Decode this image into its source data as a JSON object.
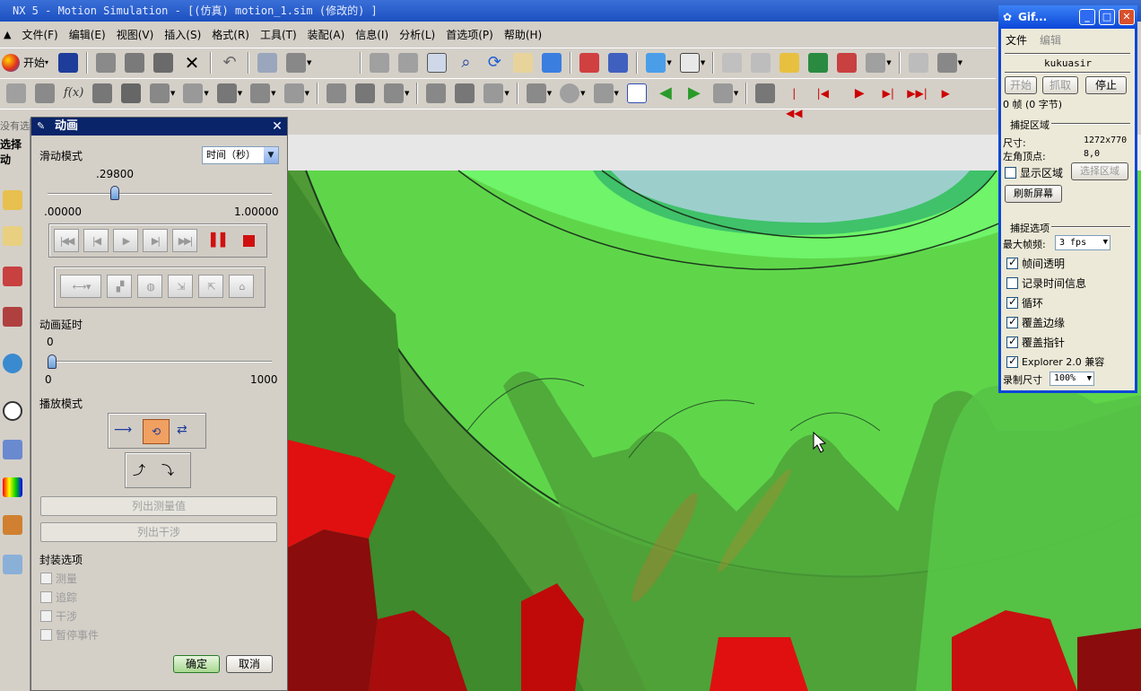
{
  "window": {
    "title": "NX 5 - Motion Simulation - [(仿真) motion_1.sim  (修改的) ]"
  },
  "menu": [
    "文件(F)",
    "编辑(E)",
    "视图(V)",
    "插入(S)",
    "格式(R)",
    "工具(T)",
    "装配(A)",
    "信息(I)",
    "分析(L)",
    "首选项(P)",
    "帮助(H)"
  ],
  "toolbar": {
    "start_label": "开始"
  },
  "left_partial": {
    "text1": "没有选",
    "text2": "选择动"
  },
  "anim": {
    "title": "动画",
    "slide_mode_label": "滑动模式",
    "slide_mode_value": "时间（秒）",
    "time_value": ".29800",
    "time_min": ".00000",
    "time_max": "1.00000",
    "time_fraction": 0.298,
    "delay_label": "动画延时",
    "delay_value": "0",
    "delay_min": "0",
    "delay_max": "1000",
    "play_mode_label": "播放模式",
    "btn_list_measure": "列出测量值",
    "btn_list_interference": "列出干涉",
    "package_label": "封装选项",
    "options": [
      "测量",
      "追踪",
      "干涉",
      "暂停事件"
    ],
    "ok": "确定",
    "cancel": "取消"
  },
  "gif": {
    "title": "Gif...",
    "menu_file": "文件",
    "menu_edit": "编辑",
    "user": "kukuasir",
    "btn_start": "开始",
    "btn_capture": "抓取",
    "btn_stop": "停止",
    "frames": "0 帧 (0 字节)",
    "capture_area_label": "捕捉区域",
    "size_label": "尺寸:",
    "size_value": "1272x770",
    "corner_label": "左角顶点:",
    "corner_value": "8,0",
    "show_area": "显示区域",
    "select_area": "选择区域",
    "refresh": "刷新屏幕",
    "capture_opts_label": "捕捉选项",
    "max_fps_label": "最大帧频:",
    "max_fps_value": "3 fps",
    "opts": [
      {
        "label": "帧间透明",
        "checked": true
      },
      {
        "label": "记录时间信息",
        "checked": false
      },
      {
        "label": "循环",
        "checked": true
      },
      {
        "label": "覆盖边缘",
        "checked": true
      },
      {
        "label": "覆盖指针",
        "checked": true
      },
      {
        "label": "Explorer 2.0 兼容",
        "checked": true
      }
    ],
    "rec_size_label": "录制尺寸",
    "rec_size_value": "100%"
  },
  "colors": {
    "nx_title": "#1c4fc0",
    "dialog_title": "#0a246a",
    "gear_green_light": "#66ee55",
    "gear_green_dark": "#3e8a2c",
    "gear_red": "#e01010"
  }
}
